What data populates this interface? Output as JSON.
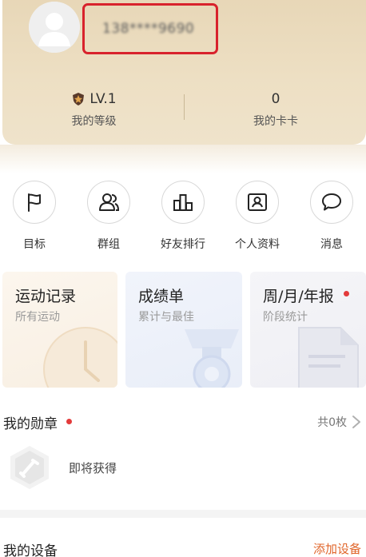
{
  "profile": {
    "phone_masked": "138****9690",
    "level_value": "LV.1",
    "level_label": "我的等级",
    "kaka_value": "0",
    "kaka_label": "我的卡卡",
    "icons": {
      "avatar": "default-user-avatar",
      "level": "shield-badge-icon"
    }
  },
  "quick_actions": [
    {
      "label": "目标",
      "icon": "flag-icon"
    },
    {
      "label": "群组",
      "icon": "group-icon"
    },
    {
      "label": "好友排行",
      "icon": "bar-chart-icon"
    },
    {
      "label": "个人资料",
      "icon": "profile-card-icon"
    },
    {
      "label": "消息",
      "icon": "message-bubble-icon"
    }
  ],
  "feature_cards": [
    {
      "title": "运动记录",
      "subtitle": "所有运动",
      "icon": "clock-icon"
    },
    {
      "title": "成绩单",
      "subtitle": "累计与最佳",
      "icon": "podium-medal-icon"
    },
    {
      "title": "周/月/年报",
      "subtitle": "阶段统计",
      "icon": "report-document-icon"
    }
  ],
  "medals": {
    "title": "我的勋章",
    "count": "共0枚",
    "item_label": "即将获得",
    "icon": "hexagon-medal-icon"
  },
  "devices": {
    "title": "我的设备",
    "action": "添加设备"
  },
  "colors": {
    "header_bg": "#ebdcc0",
    "accent_red": "#e33b3b",
    "highlight_border": "#d8222c",
    "action_orange": "#e0662b",
    "card1_bg": "#fbf4ea",
    "card2_bg": "#eef2fa",
    "card3_bg": "#f3f3f7"
  }
}
